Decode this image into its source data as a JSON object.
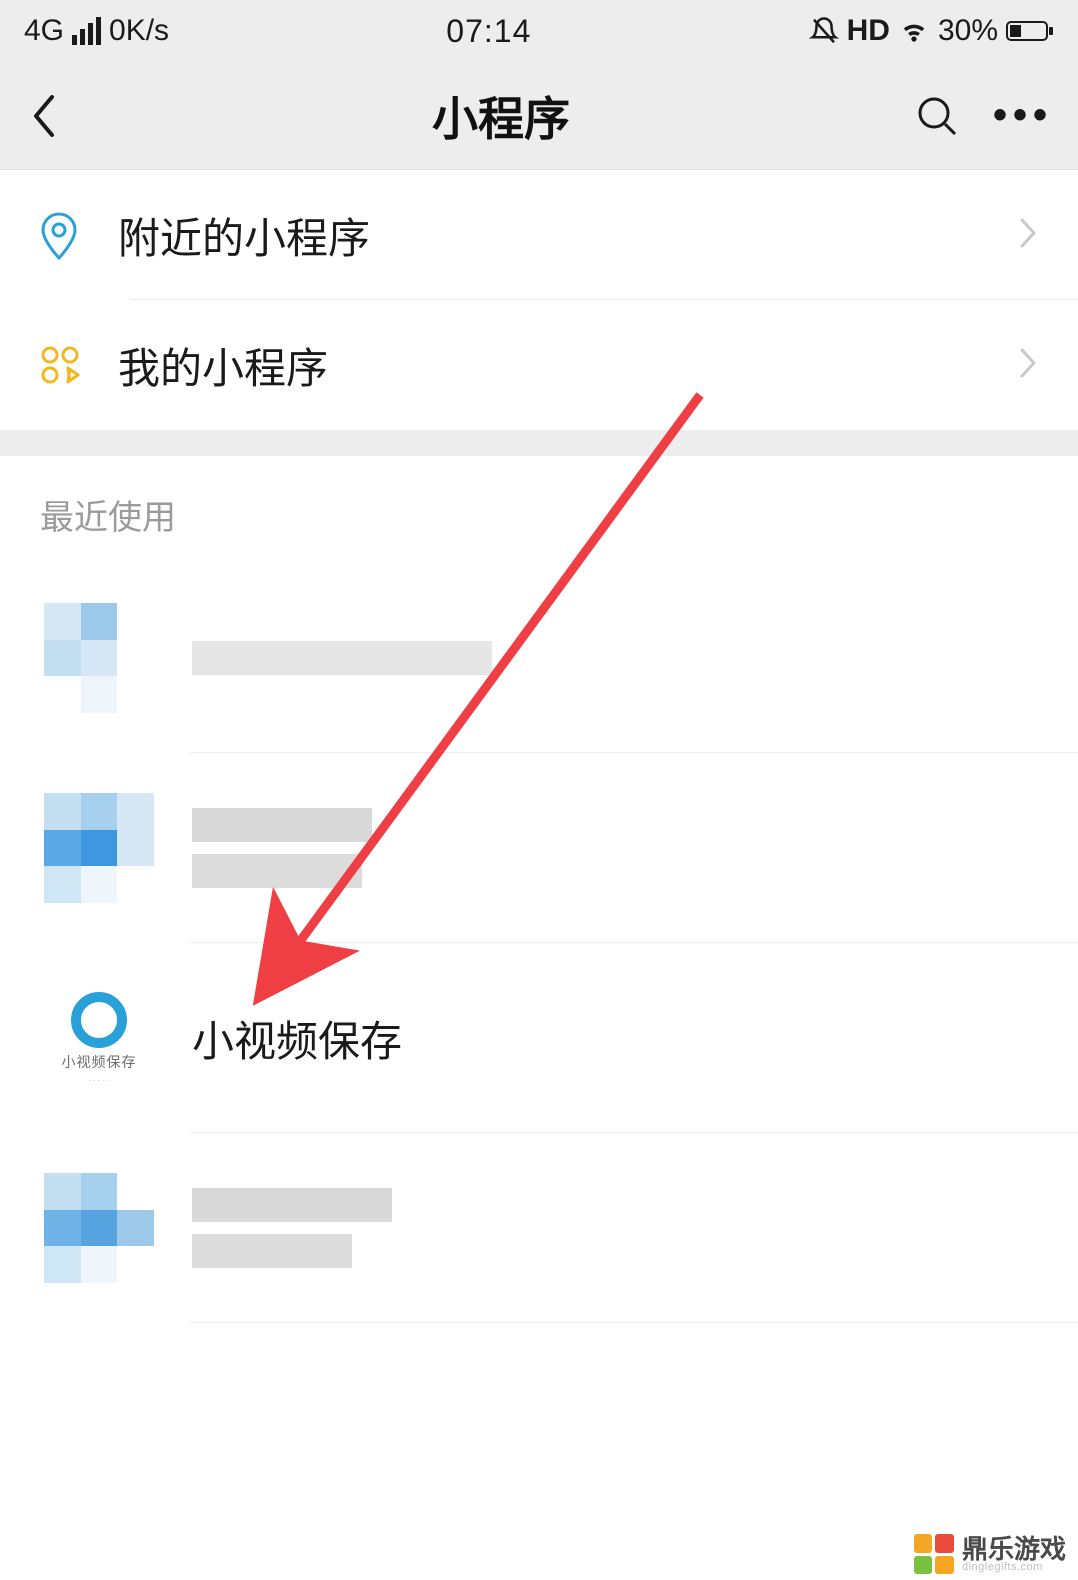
{
  "statusbar": {
    "network_type": "4G",
    "data_rate": "0K/s",
    "time": "07:14",
    "hd_label": "HD",
    "battery_percent": "30%"
  },
  "header": {
    "title": "小程序"
  },
  "menu": {
    "nearby": {
      "label": "附近的小程序"
    },
    "mine": {
      "label": "我的小程序"
    }
  },
  "recent": {
    "title": "最近使用",
    "items": [
      {
        "label": "",
        "icon": "pixelated"
      },
      {
        "label": "",
        "icon": "pixelated"
      },
      {
        "label": "小视频保存",
        "icon": "miniapp",
        "icon_caption": "小视频保存"
      },
      {
        "label": "",
        "icon": "pixelated"
      }
    ]
  },
  "annotation": {
    "arrow_color": "#ef3e44"
  },
  "watermark": {
    "brand": "鼎乐游戏",
    "domain": "dinglegifts.com"
  }
}
